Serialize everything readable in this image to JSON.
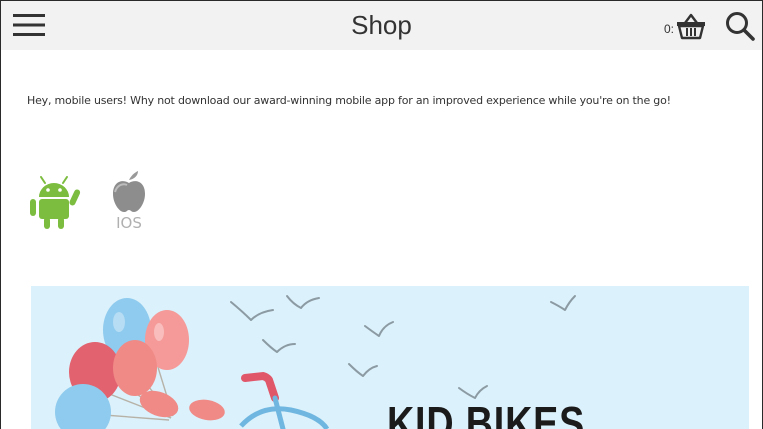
{
  "header": {
    "title": "Shop",
    "cart_count": "0:",
    "menu_icon": "hamburger-menu-icon",
    "cart_icon": "basket-icon",
    "search_icon": "search-icon"
  },
  "promo": {
    "message": "Hey, mobile users! Why not download our award-winning mobile app for an improved experience while you're on the go!"
  },
  "apps": {
    "android_icon": "android-icon",
    "ios_icon": "apple-icon",
    "ios_label": "IOS"
  },
  "banner": {
    "headline": "KID BIKES"
  },
  "colors": {
    "header_bg": "#f2f2f2",
    "android_green": "#7cbd3f",
    "banner_bg": "#dbf1fb"
  }
}
